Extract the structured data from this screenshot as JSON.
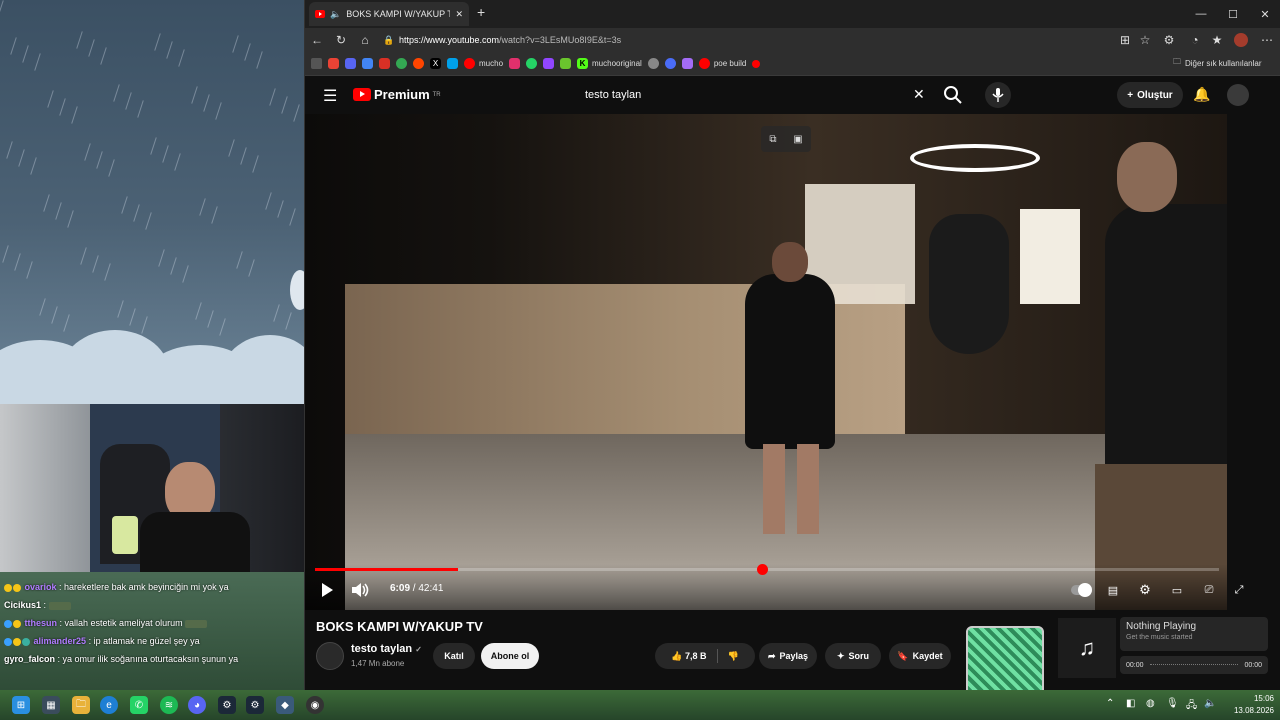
{
  "browser": {
    "tab_title": "BOKS KAMPI W/YAKUP TV - Y",
    "new_tab_label": "+",
    "url_domain": "https://www.youtube.com",
    "url_path": "/watch?v=3LEsMUo8I9E&t=3s",
    "bookmarks": [
      {
        "label": "",
        "icon": "gmail-icon",
        "color": "#ea4335"
      },
      {
        "label": "",
        "icon": "discord-icon",
        "color": "#5865f2"
      },
      {
        "label": "",
        "icon": "translate-icon",
        "color": "#4285f4"
      },
      {
        "label": "",
        "icon": "gmail-icon",
        "color": "#d93025"
      },
      {
        "label": "",
        "icon": "google-icon",
        "color": "#34a853"
      },
      {
        "label": "",
        "icon": "reddit-icon",
        "color": "#ff4500"
      },
      {
        "label": "",
        "icon": "x-icon",
        "color": "#000000"
      },
      {
        "label": "",
        "icon": "flag-icon",
        "color": "#00a0e9"
      },
      {
        "label": "mucho",
        "icon": "youtube-icon",
        "color": "#ff0000"
      },
      {
        "label": "",
        "icon": "instagram-icon",
        "color": "#e1306c"
      },
      {
        "label": "",
        "icon": "whatsapp-icon",
        "color": "#25d366"
      },
      {
        "label": "",
        "icon": "twitch-icon",
        "color": "#9146ff"
      },
      {
        "label": "",
        "icon": "puzzle-icon",
        "color": "#6ac52d"
      },
      {
        "label": "muchooriginal",
        "icon": "kick-icon",
        "color": "#53fc18"
      },
      {
        "label": "",
        "icon": "github-icon",
        "color": "#333333"
      },
      {
        "label": "",
        "icon": "vpn-icon",
        "color": "#4a6cf7"
      },
      {
        "label": "",
        "icon": "pen-icon",
        "color": "#a46cf7"
      },
      {
        "label": "poe build",
        "icon": "youtube-icon",
        "color": "#ff0000"
      },
      {
        "label": "",
        "icon": "youtube-icon",
        "color": "#ff0000"
      }
    ],
    "other_bookmarks": "Diğer sık kullanılanlar"
  },
  "youtube": {
    "logo_text": "Premium",
    "logo_region": "TR",
    "search_query": "testo taylan",
    "create_label": "Oluştur"
  },
  "video": {
    "progress": 0.158,
    "current_time": "6:09",
    "duration": "42:41",
    "title": "BOKS KAMPI W/YAKUP TV",
    "channel_name": "testo taylan",
    "verified_mark": "✓",
    "channel_subs": "1,47 Mn abone",
    "join_label": "Katıl",
    "subscribe_label": "Abone ol",
    "like_count": "7,8 B",
    "share_label": "Paylaş",
    "ask_label": "Soru",
    "save_label": "Kaydet"
  },
  "chat": [
    {
      "user": "ovariok",
      "text": ": hareketlere bak amk beyinciğin mi yok ya",
      "color": "#b07cff"
    },
    {
      "user": "Cicikus1",
      "text": ":",
      "color": "#ffffff"
    },
    {
      "user": "tthesun",
      "text": ": vallah estetik ameliyat olurum",
      "color": "#b07cff"
    },
    {
      "user": "alimander25",
      "text": ": ip atlamak ne güzel şey ya",
      "color": "#b07cff"
    },
    {
      "user": "gyro_falcon",
      "text": ": ya omur ilik soğanına oturtacaksın şunun ya",
      "color": "#ffffff"
    }
  ],
  "now_playing": {
    "title": "Nothing Playing",
    "subtitle": "Get the music started",
    "time_start": "00:00",
    "time_end": "00:00"
  },
  "taskbar": {
    "time": "15:06",
    "date": "13.08.2026"
  }
}
